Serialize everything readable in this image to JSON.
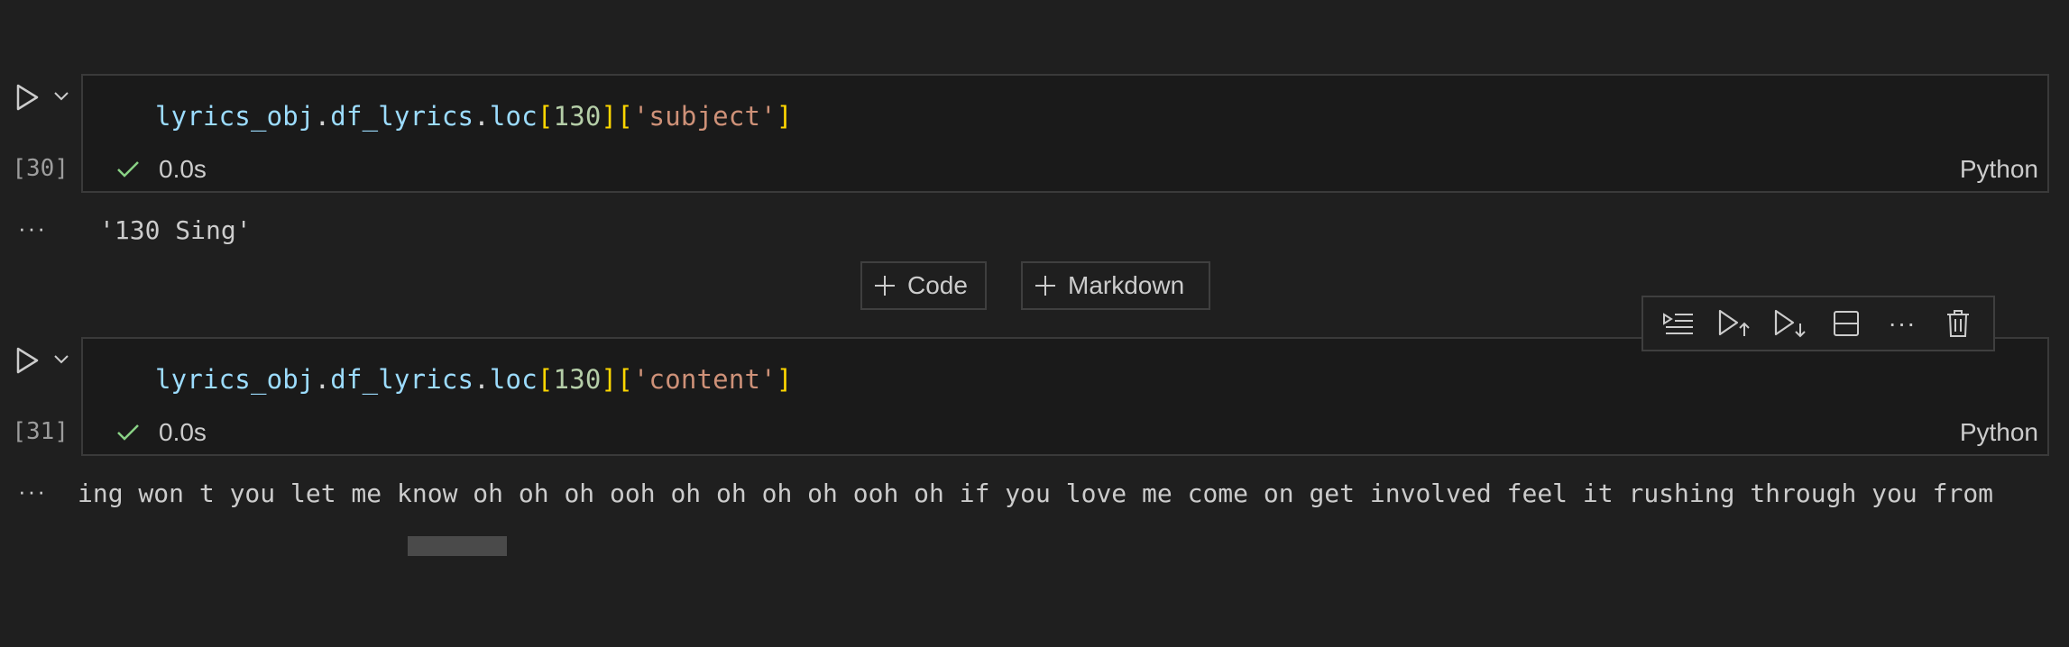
{
  "cells": [
    {
      "exec_count": "[30]",
      "code": {
        "var": "lyrics_obj",
        "dot1": ".",
        "attr1": "df_lyrics",
        "dot2": ".",
        "attr2": "loc",
        "br1_open": "[",
        "index": "130",
        "br1_close": "]",
        "br2_open": "[",
        "key": "'subject'",
        "br2_close": "]"
      },
      "duration": "0.0s",
      "language": "Python",
      "output_ellipsis": "···",
      "output": "'130 Sing'"
    },
    {
      "exec_count": "[31]",
      "code": {
        "var": "lyrics_obj",
        "dot1": ".",
        "attr1": "df_lyrics",
        "dot2": ".",
        "attr2": "loc",
        "br1_open": "[",
        "index": "130",
        "br1_close": "]",
        "br2_open": "[",
        "key": "'content'",
        "br2_close": "]"
      },
      "duration": "0.0s",
      "language": "Python",
      "output_ellipsis": "···",
      "output": "ing won t you let me know oh oh oh ooh oh oh oh oh ooh oh if you love me come on get involved feel it rushing through you from"
    }
  ],
  "add_cell": {
    "code_label": "Code",
    "markdown_label": "Markdown"
  },
  "toolbar": {
    "icons": [
      "run-by-line-icon",
      "execute-above-icon",
      "execute-below-icon",
      "split-cell-icon",
      "more-icon",
      "delete-icon"
    ],
    "more_label": "···"
  },
  "colors": {
    "background": "#1f1f1f",
    "cell_background": "#1a1a1a",
    "border": "#3a3a3a",
    "success_check": "#89d185",
    "string": "#ce9178",
    "variable": "#9cdcfe",
    "number": "#b5cea8",
    "bracket": "#ffd700"
  }
}
